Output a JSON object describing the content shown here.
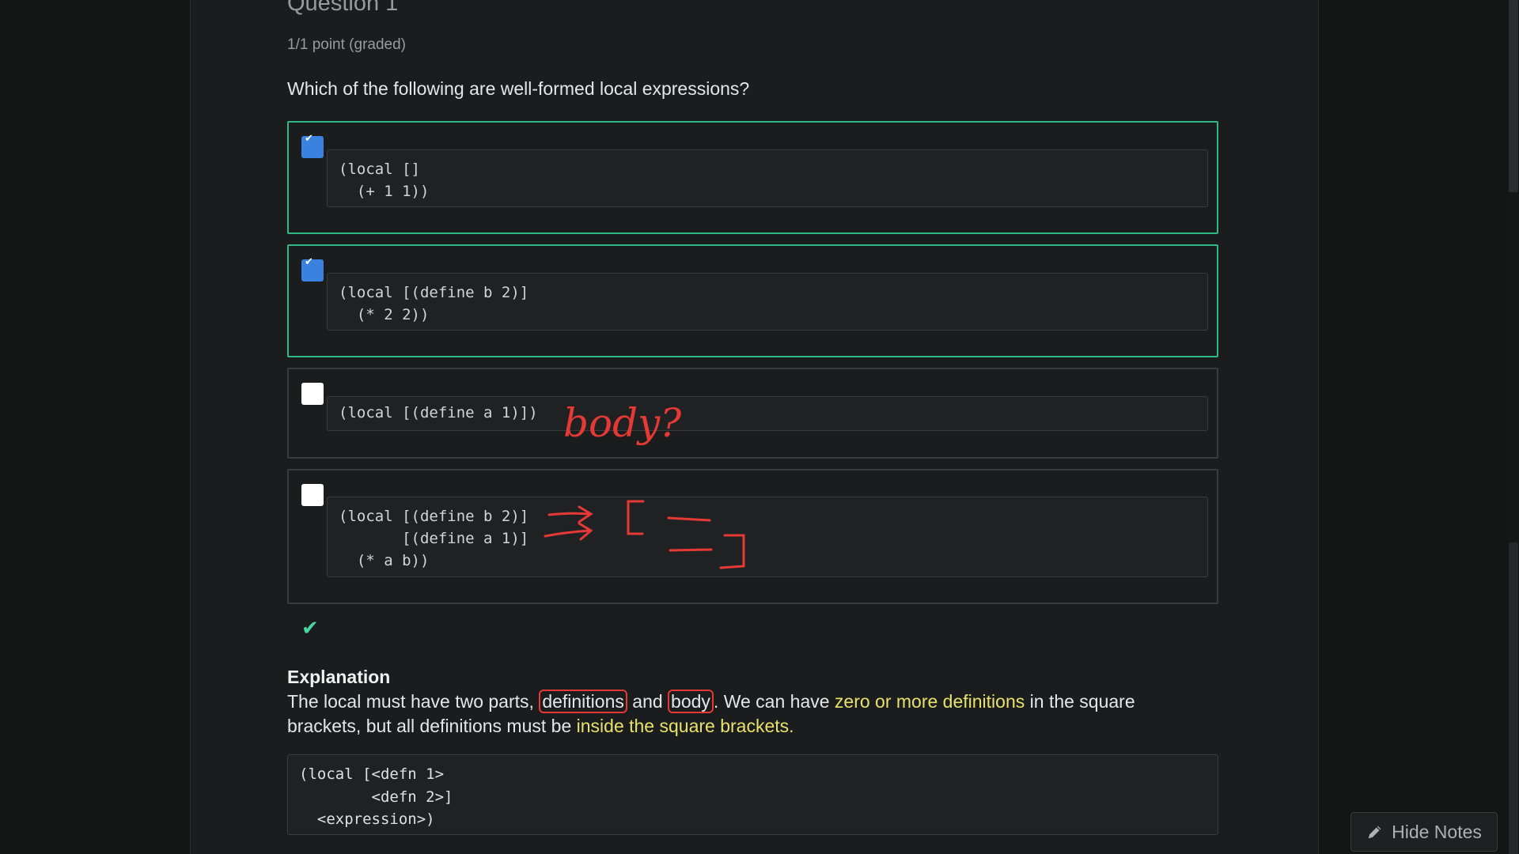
{
  "question": {
    "title": "Question 1",
    "points": "1/1 point (graded)",
    "prompt": "Which of the following are well-formed local expressions?"
  },
  "options": [
    {
      "checked": true,
      "correct": true,
      "code": "(local []\n  (+ 1 1))"
    },
    {
      "checked": true,
      "correct": true,
      "code": "(local [(define b 2)]\n  (* 2 2))"
    },
    {
      "checked": false,
      "correct": false,
      "code": "(local [(define a 1)])"
    },
    {
      "checked": false,
      "correct": false,
      "code": "(local [(define b 2)]\n       [(define a 1)]\n  (* a b))"
    }
  ],
  "result_icon": "checkmark-icon",
  "explanation": {
    "heading": "Explanation",
    "part1": "The local must have two parts, ",
    "definitions": "definitions",
    "and": " and ",
    "body": "body",
    "part2": ". We can have ",
    "highlight1": "zero or more definitions",
    "part3": " in the square brackets, but all definitions must be ",
    "highlight2": "inside the square brackets.",
    "code": "(local [<defn 1>\n        <defn 2>]\n  <expression>)"
  },
  "annotation": {
    "text": "body?",
    "color": "#e53935"
  },
  "hide_notes": {
    "label": "Hide Notes",
    "icon": "pencil-icon"
  },
  "colors": {
    "correct_border": "#2fb785",
    "checkbox_checked": "#3b82e0",
    "highlight": "#e8e26a",
    "ink": "#e53935"
  }
}
